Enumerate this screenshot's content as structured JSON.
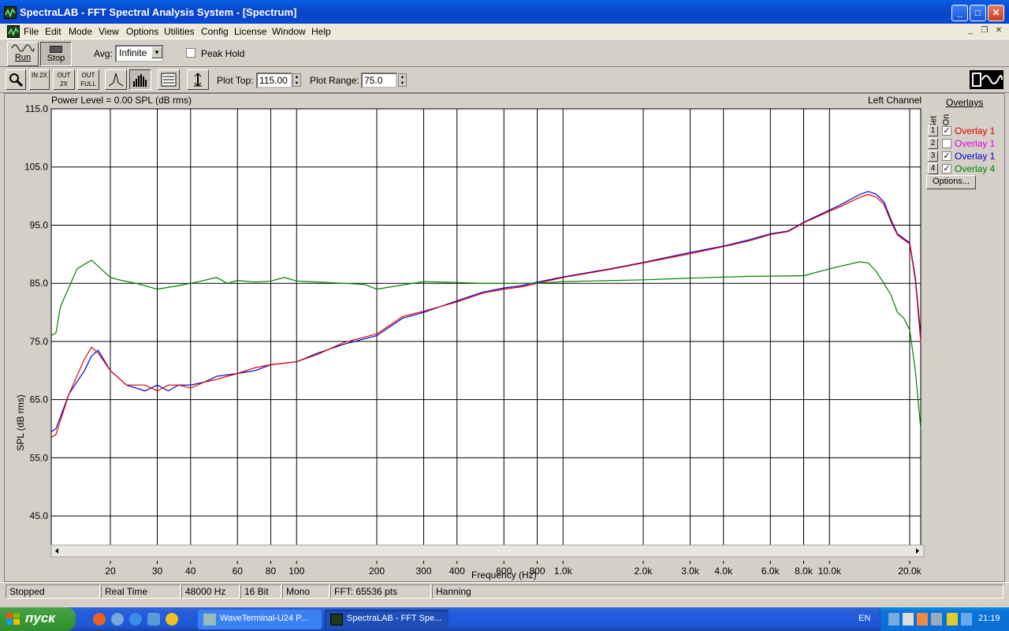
{
  "window": {
    "title": "SpectraLAB - FFT Spectral Analysis System - [Spectrum]",
    "minimize": "_",
    "maximize": "□",
    "close": "✕"
  },
  "menubar": {
    "items": [
      "File",
      "Edit",
      "Mode",
      "View",
      "Options",
      "Utilities",
      "Config",
      "License",
      "Window",
      "Help"
    ],
    "mdi_minimize": "_",
    "mdi_restore": "❐",
    "mdi_close": "✕"
  },
  "toolbar1": {
    "run_label": "Run",
    "stop_label": "Stop",
    "avg_label": "Avg:",
    "avg_value": "Infinite",
    "peak_hold_label": "Peak Hold",
    "peak_hold_checked": false
  },
  "toolbar2": {
    "zoom_in_label": "IN 2X",
    "zoom_out_label": "OUT 2X",
    "zoom_full_label": "OUT FULL",
    "plot_top_label": "Plot Top:",
    "plot_top_value": "115.00",
    "plot_range_label": "Plot Range:",
    "plot_range_value": "75.0"
  },
  "plot": {
    "power_level": "Power Level = 0.00 SPL (dB rms)",
    "channel": "Left Channel",
    "ylabel": "SPL (dB rms)",
    "xlabel": "Frequency (Hz)"
  },
  "overlays": {
    "title": "Overlays",
    "col_set": "Set",
    "col_on": "On",
    "items": [
      {
        "set": "1",
        "on": true,
        "name": "Overlay 1",
        "color": "#e00000"
      },
      {
        "set": "2",
        "on": false,
        "name": "Overlay 1",
        "color": "#e000e0"
      },
      {
        "set": "3",
        "on": true,
        "name": "Overlay 1",
        "color": "#0000d0"
      },
      {
        "set": "4",
        "on": true,
        "name": "Overlay 4",
        "color": "#008000"
      }
    ],
    "options_button": "Options..."
  },
  "chart_data": {
    "type": "line",
    "xlabel": "Frequency (Hz)",
    "ylabel": "SPL (dB rms)",
    "xscale": "log",
    "xlim": [
      12,
      22000
    ],
    "ylim": [
      40,
      115
    ],
    "y_ticks": [
      "115.0",
      "105.0",
      "95.0",
      "85.0",
      "75.0",
      "65.0",
      "55.0",
      "45.0"
    ],
    "x_ticks": [
      {
        "v": 20,
        "l": "20"
      },
      {
        "v": 30,
        "l": "30"
      },
      {
        "v": 40,
        "l": "40"
      },
      {
        "v": 60,
        "l": "60"
      },
      {
        "v": 80,
        "l": "80"
      },
      {
        "v": 100,
        "l": "100"
      },
      {
        "v": 200,
        "l": "200"
      },
      {
        "v": 300,
        "l": "300"
      },
      {
        "v": 400,
        "l": "400"
      },
      {
        "v": 600,
        "l": "600"
      },
      {
        "v": 800,
        "l": "800"
      },
      {
        "v": 1000,
        "l": "1.0k"
      },
      {
        "v": 2000,
        "l": "2.0k"
      },
      {
        "v": 3000,
        "l": "3.0k"
      },
      {
        "v": 4000,
        "l": "4.0k"
      },
      {
        "v": 6000,
        "l": "6.0k"
      },
      {
        "v": 8000,
        "l": "8.0k"
      },
      {
        "v": 10000,
        "l": "10.0k"
      },
      {
        "v": 20000,
        "l": "20.0k"
      }
    ],
    "grid": true,
    "series": [
      {
        "color": "#0000d0",
        "x": [
          12,
          12.5,
          14,
          16,
          17,
          18,
          20,
          23,
          27,
          30,
          33,
          36,
          40,
          45,
          50,
          60,
          70,
          80,
          100,
          120,
          150,
          200,
          250,
          300,
          400,
          500,
          600,
          700,
          800,
          1000,
          1500,
          2000,
          3000,
          4000,
          5000,
          6000,
          7000,
          8000,
          10000,
          11000,
          13000,
          14000,
          15000,
          16000,
          17000,
          18000,
          19000,
          20000,
          21000,
          22000
        ],
        "y": [
          59.5,
          60,
          66,
          70,
          72.5,
          73.5,
          70,
          67.5,
          66.5,
          67.5,
          66.5,
          67.5,
          67.5,
          68,
          69,
          69.5,
          70,
          71,
          71.5,
          73,
          74.5,
          76,
          79,
          80,
          82,
          83.5,
          84.2,
          84.6,
          85.2,
          86.1,
          87.5,
          88.6,
          90.3,
          91.4,
          92.5,
          93.5,
          94,
          95.5,
          97.6,
          98.5,
          100.3,
          100.8,
          100.3,
          99,
          96,
          93.5,
          92.7,
          92,
          86,
          76
        ]
      },
      {
        "color": "#e00000",
        "x": [
          12,
          12.5,
          14,
          16,
          17,
          18,
          20,
          23,
          27,
          30,
          33,
          36,
          40,
          45,
          50,
          60,
          70,
          80,
          100,
          120,
          150,
          200,
          250,
          300,
          400,
          500,
          600,
          700,
          800,
          1000,
          1500,
          2000,
          3000,
          4000,
          5000,
          6000,
          7000,
          8000,
          10000,
          11000,
          13000,
          14000,
          15000,
          16000,
          17000,
          18000,
          19000,
          20000,
          21000,
          22000
        ],
        "y": [
          58.5,
          59,
          66,
          72,
          74,
          73,
          70,
          67.5,
          67.5,
          66.5,
          67.5,
          67.5,
          67,
          68,
          68.5,
          69.5,
          70.5,
          71,
          71.5,
          72.8,
          74.8,
          76.3,
          79.3,
          80.2,
          81.8,
          83.3,
          84,
          84.4,
          85,
          86,
          87.4,
          88.5,
          90.1,
          91.3,
          92.3,
          93.4,
          93.9,
          95.4,
          97.4,
          98.2,
          99.8,
          100.3,
          99.8,
          98.6,
          95.6,
          93.3,
          92.5,
          91.8,
          85.5,
          75
        ]
      },
      {
        "color": "#008000",
        "x": [
          12,
          12.5,
          13,
          15,
          17,
          20,
          22,
          25,
          30,
          35,
          40,
          45,
          50,
          55,
          60,
          70,
          80,
          90,
          100,
          150,
          180,
          200,
          300,
          500,
          800,
          1000,
          2000,
          3000,
          5000,
          8000,
          10000,
          13000,
          14000,
          15000,
          16000,
          17000,
          18000,
          19000,
          20000,
          21000,
          22000
        ],
        "y": [
          76,
          76.5,
          81,
          87.5,
          89,
          86,
          85.5,
          85,
          84,
          84.5,
          85,
          85.5,
          86,
          85,
          85.5,
          85.2,
          85.4,
          86,
          85.4,
          85,
          84.8,
          84,
          85.3,
          85,
          85,
          85.3,
          85.6,
          85.9,
          86.2,
          86.3,
          87.5,
          88.7,
          88.5,
          87,
          85,
          83,
          80,
          79,
          77,
          70,
          60
        ]
      }
    ]
  },
  "statusbar": {
    "state": "Stopped",
    "mode": "Real Time",
    "rate": "48000 Hz",
    "bits": "16 Bit",
    "channels": "Mono",
    "fft": "FFT: 65536 pts",
    "window": "Hanning"
  },
  "taskbar": {
    "start_label": "пуск",
    "tasks": [
      {
        "label": "WaveTerminal-U24 P...",
        "active": false
      },
      {
        "label": "SpectraLAB - FFT Spe...",
        "active": true
      }
    ],
    "lang": "EN",
    "clock": "21:19"
  }
}
